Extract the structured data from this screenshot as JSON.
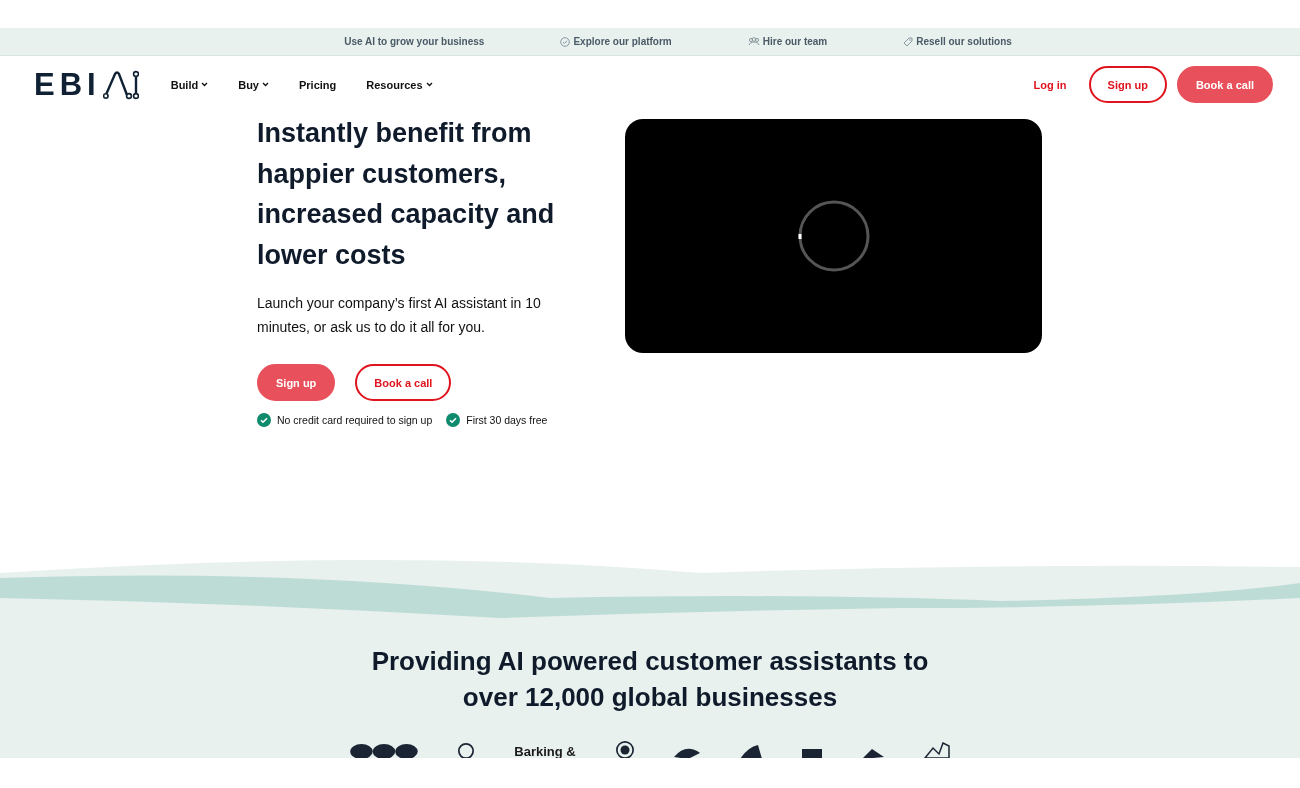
{
  "top_bar": [
    {
      "label": "Use AI to grow your business"
    },
    {
      "label": "Explore our platform"
    },
    {
      "label": "Hire our team"
    },
    {
      "label": "Resell our solutions"
    }
  ],
  "nav": {
    "logo": "EBI",
    "menu": [
      {
        "label": "Build",
        "dropdown": true
      },
      {
        "label": "Buy",
        "dropdown": true
      },
      {
        "label": "Pricing",
        "dropdown": false
      },
      {
        "label": "Resources",
        "dropdown": true
      }
    ],
    "login": "Log in",
    "signup": "Sign up",
    "book": "Book a call"
  },
  "hero": {
    "title": "Instantly benefit from happier customers, increased capacity and lower costs",
    "subtitle": "Launch your company’s first AI assistant in 10 minutes, or ask us to do it all for you.",
    "primary": "Sign up",
    "secondary": "Book a call",
    "perks": [
      "No credit card required to sign up",
      "First 30 days free"
    ]
  },
  "clients": {
    "title": "Providing AI powered customer assistants to over 12,000 global businesses",
    "logo_text": "Barking &"
  }
}
